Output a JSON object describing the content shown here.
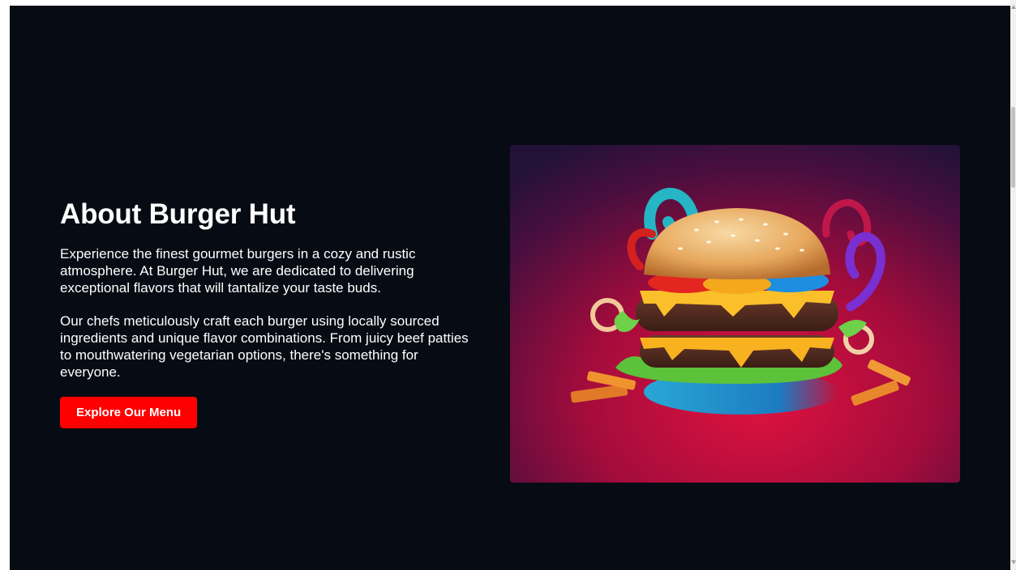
{
  "about": {
    "title": "About Burger Hut",
    "paragraphs": [
      "Experience the finest gourmet burgers in a cozy and rustic atmosphere. At Burger Hut, we are dedicated to delivering exceptional flavors that will tantalize your taste buds.",
      "Our chefs meticulously craft each burger using locally sourced ingredients and unique flavor combinations. From juicy beef patties to mouthwatering vegetarian options, there's something for everyone."
    ],
    "cta_label": "Explore Our Menu"
  },
  "colors": {
    "background": "#070c14",
    "accent": "#ff0000",
    "text": "#ffffff"
  },
  "image": {
    "subject": "gourmet-burger-illustration"
  }
}
